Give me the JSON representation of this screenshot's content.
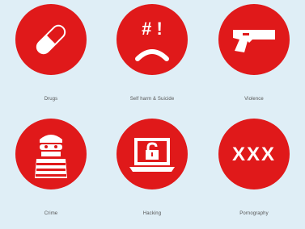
{
  "brand": {
    "accent": "#e0191a",
    "accent_dark": "#c8102e"
  },
  "categories": [
    {
      "label": "Drugs",
      "icon": "pill-icon"
    },
    {
      "label": "Self harm & Suicide",
      "icon": "sad-face-icon"
    },
    {
      "label": "Violence",
      "icon": "gun-icon"
    },
    {
      "label": "Crime",
      "icon": "burglar-icon"
    },
    {
      "label": "Hacking",
      "icon": "laptop-lock-icon"
    },
    {
      "label": "Pornography",
      "icon": "xxx-icon"
    }
  ],
  "icon_text": {
    "selfharm_symbols": "# !",
    "porn_text": "XXX"
  }
}
